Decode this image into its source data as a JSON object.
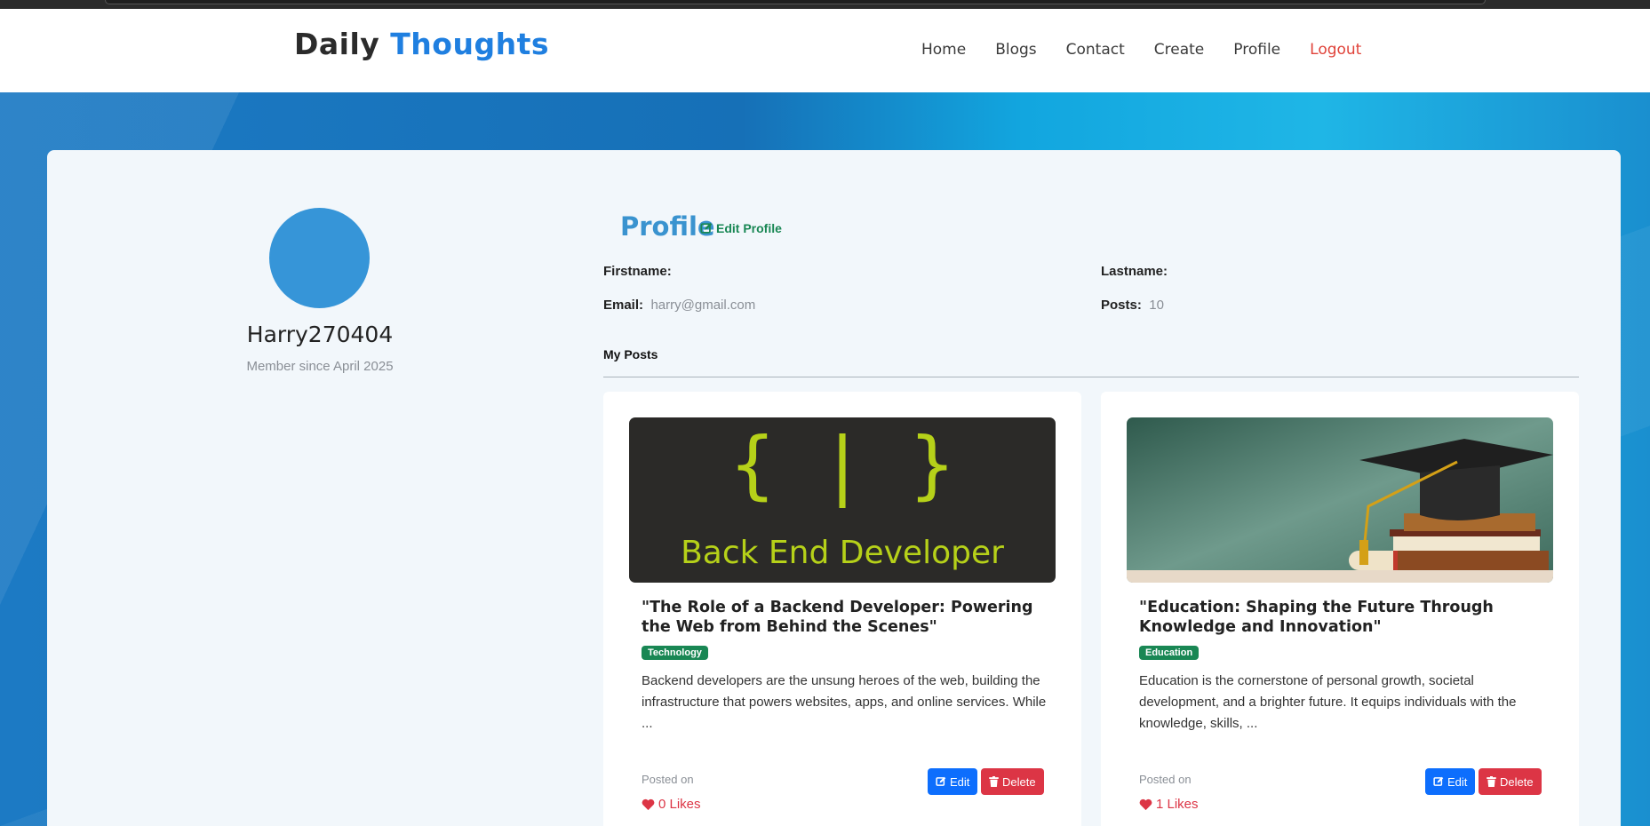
{
  "brand": {
    "part1": "Daily",
    "part2": "Thoughts"
  },
  "nav": {
    "home": "Home",
    "blogs": "Blogs",
    "contact": "Contact",
    "create": "Create",
    "profile": "Profile",
    "logout": "Logout"
  },
  "user": {
    "username": "Harry270404",
    "member_since": "Member since April 2025"
  },
  "profile": {
    "title": "Profile",
    "edit_label": "Edit Profile",
    "firstname_label": "Firstname:",
    "firstname_value": "",
    "lastname_label": "Lastname:",
    "lastname_value": "",
    "email_label": "Email:",
    "email_value": "harry@gmail.com",
    "posts_label": "Posts:",
    "posts_value": "10",
    "my_posts_heading": "My Posts"
  },
  "posts": [
    {
      "image_text": "Back End Developer",
      "image_braces": "{ | }",
      "title": "\"The Role of a Backend Developer: Powering the Web from Behind the Scenes\"",
      "tag": "Technology",
      "excerpt": "Backend developers are the unsung heroes of the web, building the infrastructure that powers websites, apps, and online services. While ...",
      "posted_on": "Posted on",
      "likes": "0 Likes",
      "edit_label": "Edit",
      "delete_label": "Delete"
    },
    {
      "title": "\"Education: Shaping the Future Through Knowledge and Innovation\"",
      "tag": "Education",
      "excerpt": "Education is the cornerstone of personal growth, societal development, and a brighter future. It equips individuals with the knowledge, skills, ...",
      "posted_on": "Posted on",
      "likes": "1 Likes",
      "edit_label": "Edit",
      "delete_label": "Delete"
    }
  ],
  "colors": {
    "brand_accent": "#1f7fe0",
    "logout": "#e0433a",
    "profile_title": "#3a93cf",
    "success": "#198754",
    "primary": "#0d6efd",
    "danger": "#dc3545"
  }
}
